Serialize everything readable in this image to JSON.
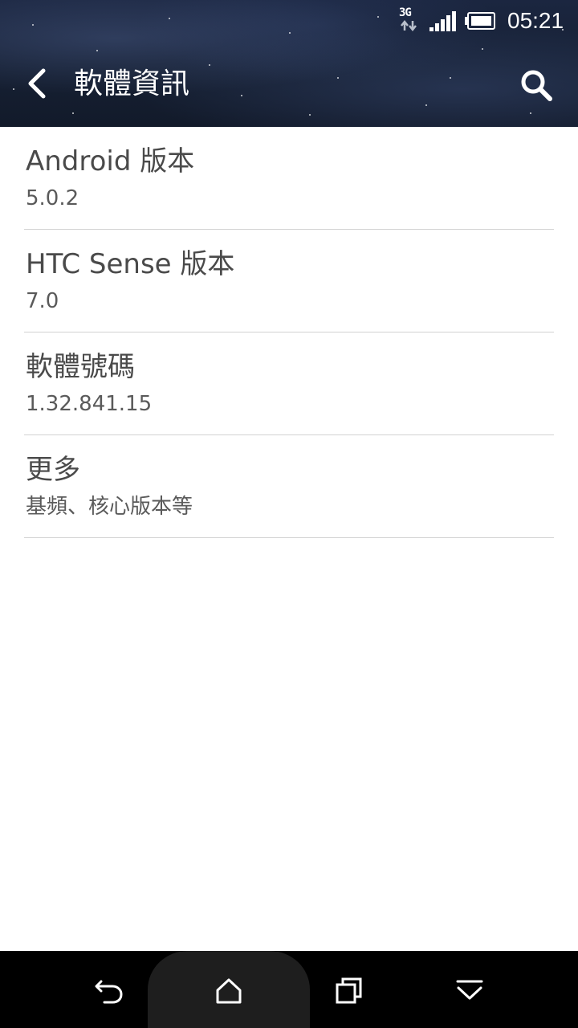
{
  "status_bar": {
    "network_type": "3G",
    "time": "05:21",
    "icons": [
      "network-3g-icon",
      "signal-icon",
      "battery-icon"
    ]
  },
  "action_bar": {
    "title": "軟體資訊",
    "back_icon": "chevron-left-icon",
    "search_icon": "search-icon"
  },
  "items": [
    {
      "title": "Android 版本",
      "value": "5.0.2"
    },
    {
      "title": "HTC Sense 版本",
      "value": "7.0"
    },
    {
      "title": "軟體號碼",
      "value": "1.32.841.15"
    },
    {
      "title": "更多",
      "value": "基頻、核心版本等"
    }
  ],
  "navigation_bar": {
    "buttons": [
      "back-icon",
      "home-icon",
      "recents-icon",
      "hide-navbar-icon"
    ]
  },
  "colors": {
    "header_bg": "#162033",
    "text_primary": "#4a4a4a",
    "text_secondary": "#5a5a5a",
    "divider": "#d2d2d2",
    "navbar_bg": "#000000"
  }
}
